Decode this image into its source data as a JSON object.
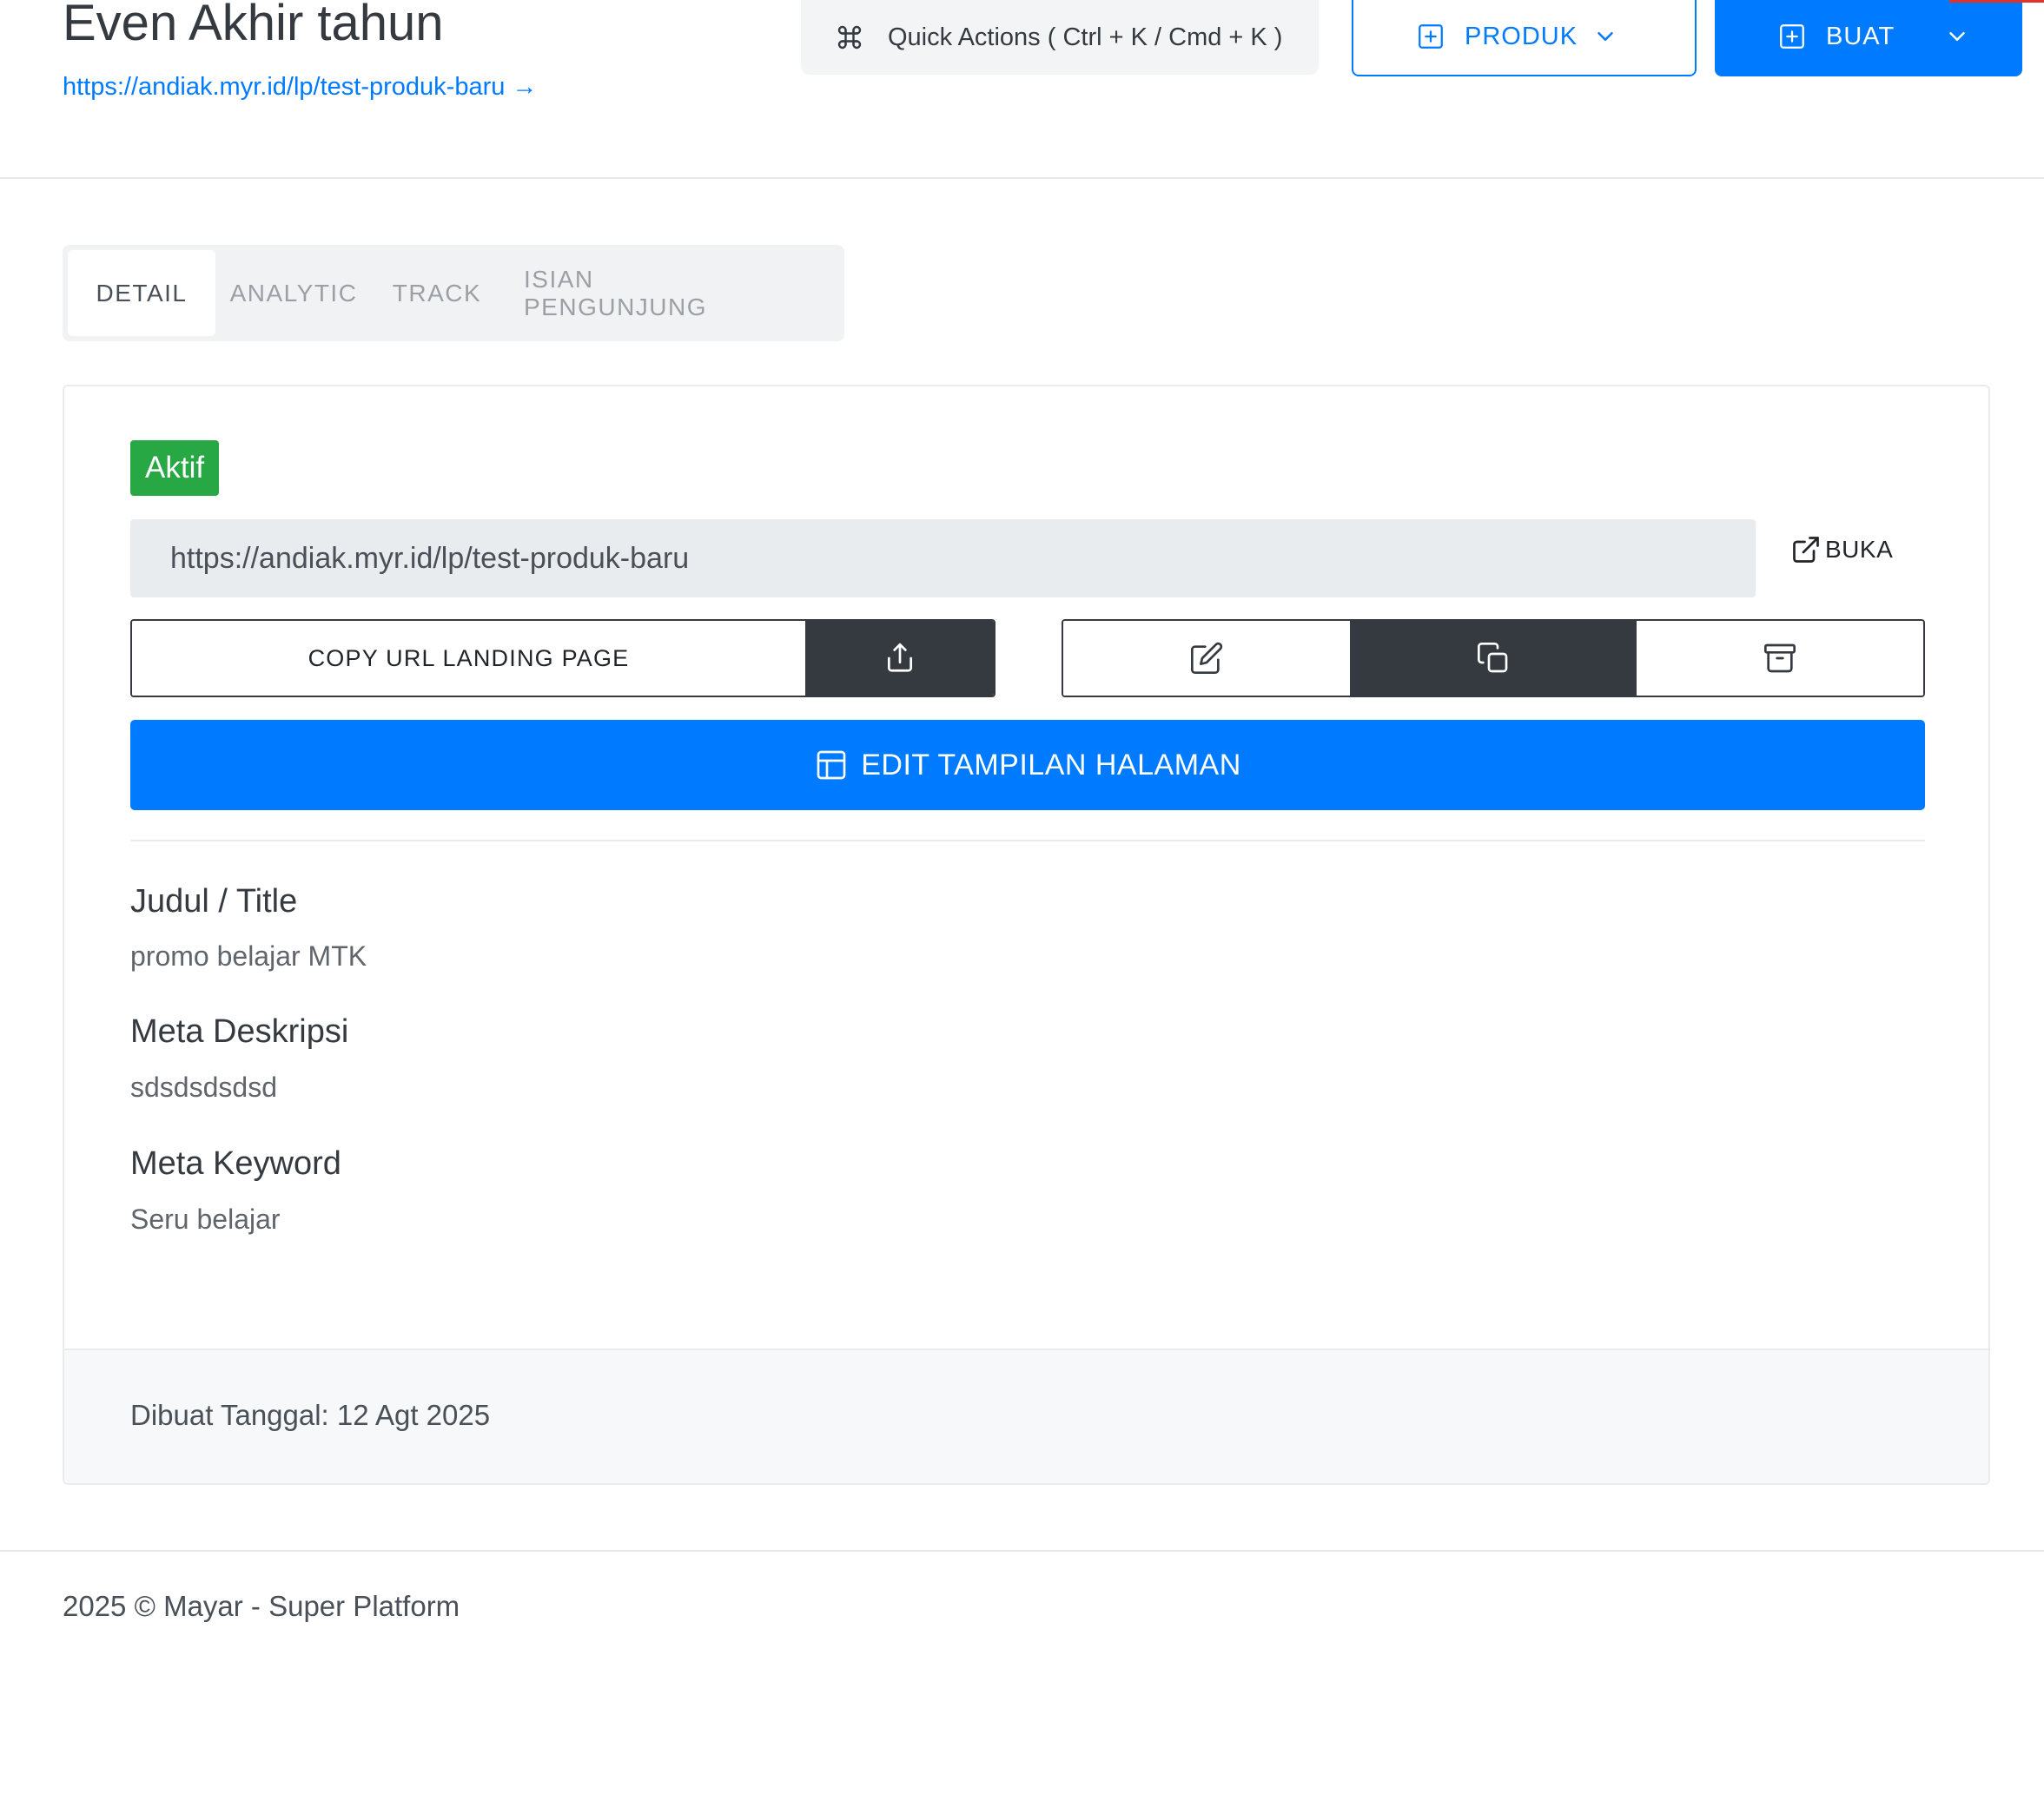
{
  "header": {
    "title": "Even Akhir tahun",
    "link_text": "https://andiak.myr.id/lp/test-produk-baru →",
    "quick_actions_label": "Quick Actions ( Ctrl + K / Cmd + K )",
    "produk_label": "PRODUK",
    "buat_label": "BUAT"
  },
  "tabs": [
    {
      "label": "DETAIL",
      "active": true
    },
    {
      "label": "ANALYTIC",
      "active": false
    },
    {
      "label": "TRACK",
      "active": false
    },
    {
      "label": "ISIAN PENGUNJUNG",
      "active": false
    }
  ],
  "card": {
    "status_badge": "Aktif",
    "url_value": "https://andiak.myr.id/lp/test-produk-baru",
    "open_label": "BUKA",
    "copy_url_label": "COPY URL LANDING PAGE",
    "edit_page_label": "EDIT TAMPILAN HALAMAN",
    "fields": {
      "title_label": "Judul / Title",
      "title_value": "promo belajar MTK",
      "desc_label": "Meta Deskripsi",
      "desc_value": "sdsdsdsdsd",
      "keyword_label": "Meta Keyword",
      "keyword_value": "Seru belajar"
    },
    "created_text": "Dibuat Tanggal: 12 Agt 2025"
  },
  "footer": {
    "copyright": "2025 © Mayar - Super Platform"
  },
  "icons": {
    "quick_actions": "command-icon",
    "produk": "plus-square-icon",
    "buat": "plus-square-icon",
    "dropdown": "chevron-down-icon",
    "buka": "external-link-icon",
    "share": "share-upload-icon",
    "edit": "edit-icon",
    "duplicate": "copy-icon",
    "archive": "archive-icon",
    "edit_page": "layout-icon"
  },
  "colors": {
    "primary": "#007bff",
    "success": "#28a745",
    "dark": "#343a40"
  }
}
